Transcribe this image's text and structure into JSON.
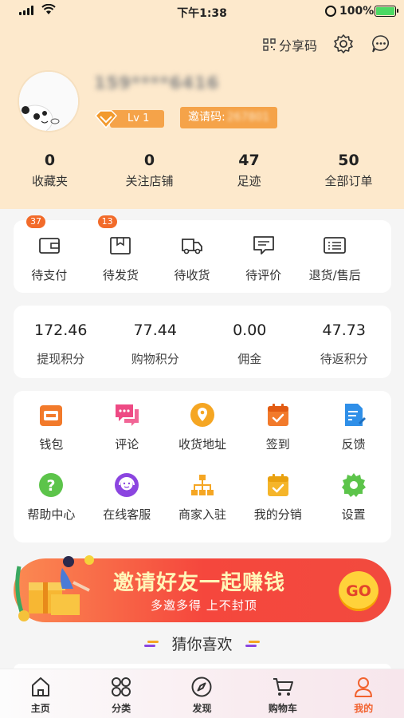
{
  "status": {
    "time": "下午1:38",
    "battery": "100%"
  },
  "header": {
    "share_label": "分享码",
    "username": "159****6416",
    "level": "Lv 1",
    "invite_label": "邀请码:",
    "invite_code": "267801"
  },
  "stats": [
    {
      "value": "0",
      "label": "收藏夹"
    },
    {
      "value": "0",
      "label": "关注店铺"
    },
    {
      "value": "47",
      "label": "足迹"
    },
    {
      "value": "50",
      "label": "全部订单"
    }
  ],
  "orders": [
    {
      "label": "待支付",
      "badge": "37",
      "icon": "wallet-icon"
    },
    {
      "label": "待发货",
      "badge": "13",
      "icon": "package-icon"
    },
    {
      "label": "待收货",
      "badge": "",
      "icon": "truck-icon"
    },
    {
      "label": "待评价",
      "badge": "",
      "icon": "comment-icon"
    },
    {
      "label": "退货/售后",
      "badge": "",
      "icon": "return-list-icon"
    }
  ],
  "points": [
    {
      "value": "172.46",
      "label": "提现积分"
    },
    {
      "value": "77.44",
      "label": "购物积分"
    },
    {
      "value": "0.00",
      "label": "佣金"
    },
    {
      "value": "47.73",
      "label": "待返积分"
    }
  ],
  "tools": [
    {
      "label": "钱包",
      "icon": "wallet-icon",
      "color": "#f27a2b"
    },
    {
      "label": "评论",
      "icon": "chat-bubbles-icon",
      "color": "#ee4a84"
    },
    {
      "label": "收货地址",
      "icon": "location-pin-icon",
      "color": "#f5a623"
    },
    {
      "label": "签到",
      "icon": "calendar-check-icon",
      "color": "#f27a2b"
    },
    {
      "label": "反馈",
      "icon": "feedback-doc-icon",
      "color": "#2f8fe8"
    },
    {
      "label": "帮助中心",
      "icon": "help-icon",
      "color": "#5cc44a"
    },
    {
      "label": "在线客服",
      "icon": "customer-service-icon",
      "color": "#8b45e0"
    },
    {
      "label": "商家入驻",
      "icon": "org-chart-icon",
      "color": "#f5a623"
    },
    {
      "label": "我的分销",
      "icon": "calendar-check-icon",
      "color": "#f5a623"
    },
    {
      "label": "设置",
      "icon": "gear-icon",
      "color": "#5cc44a"
    }
  ],
  "banner": {
    "title": "邀请好友一起赚钱",
    "subtitle": "多邀多得 上不封顶",
    "go": "GO"
  },
  "guess_title": "猜你喜欢",
  "tabs": [
    {
      "label": "主页",
      "icon": "home-icon",
      "active": false
    },
    {
      "label": "分类",
      "icon": "category-icon",
      "active": false
    },
    {
      "label": "发现",
      "icon": "compass-icon",
      "active": false
    },
    {
      "label": "购物车",
      "icon": "cart-icon",
      "active": false
    },
    {
      "label": "我的",
      "icon": "user-icon",
      "active": true
    }
  ],
  "colors": {
    "header_bg": "#fde9cc",
    "accent": "#f5a349",
    "active_tab": "#f2622e",
    "badge": "#f26b2a"
  }
}
